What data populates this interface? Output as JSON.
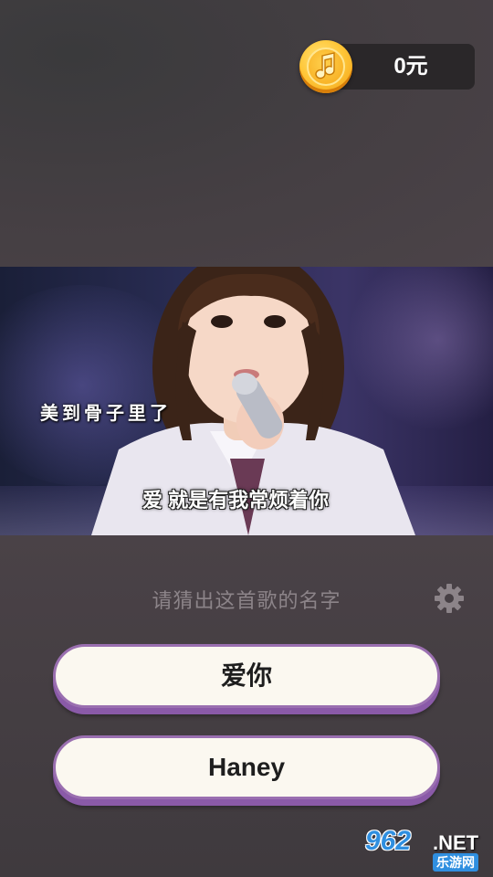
{
  "wallet": {
    "balance": "0元",
    "coin_icon": "music-note-coin-icon"
  },
  "video": {
    "lyric_side": "美到骨子里了",
    "lyric_main": "爱 就是有我常烦着你"
  },
  "quiz": {
    "question": "请猜出这首歌的名字",
    "settings_icon": "gear-icon",
    "options": [
      {
        "label": "爱你"
      },
      {
        "label": "Haney"
      }
    ]
  },
  "watermark": {
    "logo": "962",
    "net": ".NET",
    "site": "乐游网"
  },
  "colors": {
    "background": "#463f44",
    "coin_gold": "#ffc83a",
    "answer_bg": "#fbf8f0",
    "answer_border": "#9a6fb0"
  }
}
